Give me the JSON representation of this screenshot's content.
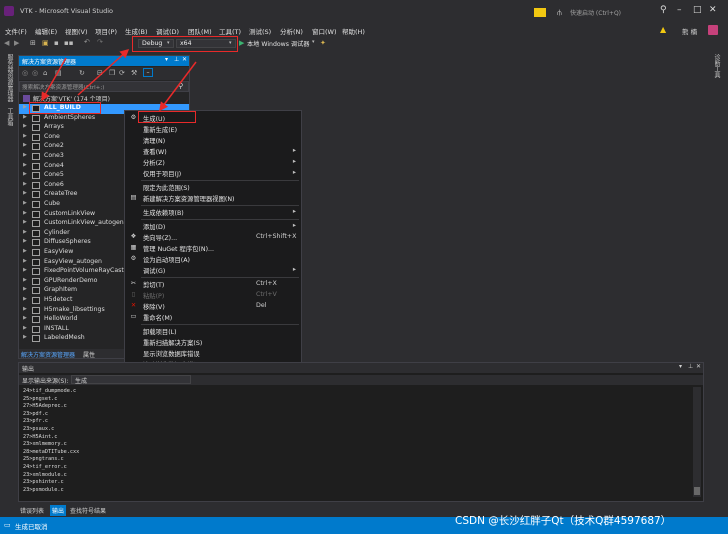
{
  "window": {
    "title": "VTK - Microsoft Visual Studio",
    "quick_launch": "快速启动 (Ctrl+Q)",
    "user": "熊 楠"
  },
  "menu": [
    "文件(F)",
    "编辑(E)",
    "视图(V)",
    "项目(P)",
    "生成(B)",
    "调试(D)",
    "团队(M)",
    "工具(T)",
    "测试(S)",
    "分析(N)",
    "窗口(W)",
    "帮助(H)"
  ],
  "toolbar": {
    "config": "Debug",
    "platform": "x64",
    "debugger": "本地 Windows 调试器"
  },
  "left_strip": [
    "服务器资源管理器",
    "工具箱"
  ],
  "right_strip": [
    "诊断工具"
  ],
  "explorer": {
    "title": "解决方案资源管理器",
    "search_placeholder": "搜索解决方案资源管理器(Ctrl+;)",
    "solution": "解决方案'VTK' (174 个项目)",
    "projects": [
      "ALL_BUILD",
      "AmbientSpheres",
      "Arrays",
      "Cone",
      "Cone2",
      "Cone3",
      "Cone4",
      "Cone5",
      "Cone6",
      "CreateTree",
      "Cube",
      "CustomLinkView",
      "CustomLinkView_autogen",
      "Cylinder",
      "DiffuseSpheres",
      "EasyView",
      "EasyView_autogen",
      "FixedPointVolumeRayCastM",
      "GPURenderDemo",
      "GraphItem",
      "H5detect",
      "H5make_libsettings",
      "HelloWorld",
      "INSTALL",
      "LabeledMesh"
    ],
    "tabs": [
      "解决方案资源管理器",
      "属性"
    ]
  },
  "context_menu": [
    {
      "label": "生成(U)",
      "key": "",
      "icon": "build-icon",
      "sub": false
    },
    {
      "label": "重新生成(E)",
      "key": "",
      "icon": "",
      "sub": false
    },
    {
      "label": "清理(N)",
      "key": "",
      "icon": "",
      "sub": false
    },
    {
      "label": "查看(W)",
      "key": "",
      "icon": "",
      "sub": true
    },
    {
      "label": "分析(Z)",
      "key": "",
      "icon": "",
      "sub": true
    },
    {
      "label": "仅用于项目(J)",
      "key": "",
      "icon": "",
      "sub": true
    },
    {
      "sep": true
    },
    {
      "label": "限定为此范围(S)",
      "key": "",
      "icon": "",
      "sub": false
    },
    {
      "label": "新建解决方案资源管理器视图(N)",
      "key": "",
      "icon": "new-view-icon",
      "sub": false
    },
    {
      "sep": true
    },
    {
      "label": "生成依赖项(B)",
      "key": "",
      "icon": "",
      "sub": true
    },
    {
      "sep": true
    },
    {
      "label": "添加(D)",
      "key": "",
      "icon": "",
      "sub": true
    },
    {
      "label": "类向导(Z)...",
      "key": "Ctrl+Shift+X",
      "icon": "class-wizard-icon",
      "sub": false
    },
    {
      "label": "管理 NuGet 程序包(N)...",
      "key": "",
      "icon": "nuget-icon",
      "sub": false
    },
    {
      "label": "设为启动项目(A)",
      "key": "",
      "icon": "gear-icon",
      "sub": false
    },
    {
      "label": "调试(G)",
      "key": "",
      "icon": "",
      "sub": true
    },
    {
      "sep": true
    },
    {
      "label": "剪切(T)",
      "key": "Ctrl+X",
      "icon": "cut-icon",
      "sub": false
    },
    {
      "label": "粘贴(P)",
      "key": "Ctrl+V",
      "icon": "paste-icon",
      "sub": false,
      "disabled": true
    },
    {
      "label": "移除(V)",
      "key": "Del",
      "icon": "remove-icon",
      "sub": false
    },
    {
      "label": "重命名(M)",
      "key": "",
      "icon": "rename-icon",
      "sub": false
    },
    {
      "sep": true
    },
    {
      "label": "卸载项目(L)",
      "key": "",
      "icon": "",
      "sub": false
    },
    {
      "label": "重新扫描解决方案(S)",
      "key": "",
      "icon": "",
      "sub": false
    },
    {
      "label": "显示浏览数据库错误",
      "key": "",
      "icon": "",
      "sub": false
    },
    {
      "label": "清除浏览数据库错误",
      "key": "",
      "icon": "",
      "sub": false
    },
    {
      "sep": true
    },
    {
      "label": "在文件资源管理器中打开文件夹(X)",
      "key": "",
      "icon": "open-folder-icon",
      "sub": false
    },
    {
      "sep": true
    },
    {
      "label": "属性(R)",
      "key": "Alt+Enter",
      "icon": "wrench-icon",
      "sub": false
    }
  ],
  "output": {
    "title": "输出",
    "source_label": "显示输出来源(S):",
    "source_value": "生成",
    "lines": [
      "24>tif_dumpmode.c",
      "25>pngset.c",
      "27>H5Adeprec.c",
      "23>pdf.c",
      "23>pfr.c",
      "23>psaux.c",
      "27>H5Aint.c",
      "23>xmlmemory.c",
      "28>metaDTITube.cxx",
      "25>pngtrans.c",
      "24>tif_error.c",
      "23>xmlmodule.c",
      "23>pshinter.c",
      "23>psmodule.c"
    ]
  },
  "bottom_tabs": [
    "错误列表",
    "输出",
    "查找符号结果"
  ],
  "status": "生成已取消",
  "watermark": "CSDN @长沙红胖子Qt（技术Q群4597687）"
}
